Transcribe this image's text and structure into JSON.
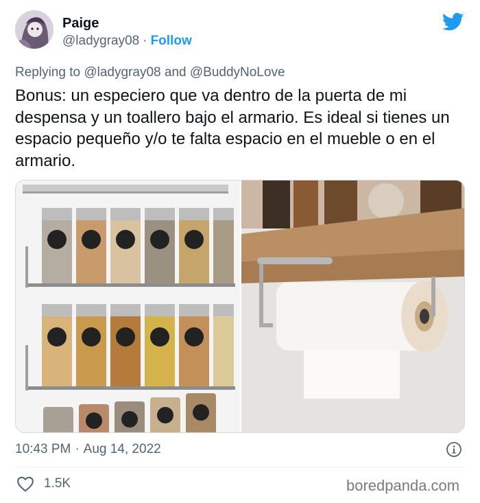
{
  "author": {
    "name": "Paige",
    "handle": "@ladygray08",
    "separator": "·",
    "follow_label": "Follow"
  },
  "reply": {
    "prefix": "Replying to",
    "mention1": "@ladygray08",
    "conjunction": "and",
    "mention2": "@BuddyNoLove"
  },
  "tweet": {
    "text": "Bonus: un especiero que va dentro de la puerta de mi despensa y un toallero bajo el armario. Es ideal si tienes un espacio pequeño y/o te falta espacio en el mueble o en el armario."
  },
  "media": {
    "left_image": "spice-rack-photo",
    "right_image": "paper-towel-holder-photo"
  },
  "meta": {
    "time": "10:43 PM",
    "separator": "·",
    "date": "Aug 14, 2022"
  },
  "engagement": {
    "likes": "1.5K"
  },
  "watermark": "boredpanda.com",
  "icons": {
    "brand": "twitter-bird-icon",
    "info": "info-icon",
    "like": "heart-icon"
  },
  "colors": {
    "accent": "#1d9bf0",
    "text": "#0f1419",
    "secondary": "#536471"
  }
}
